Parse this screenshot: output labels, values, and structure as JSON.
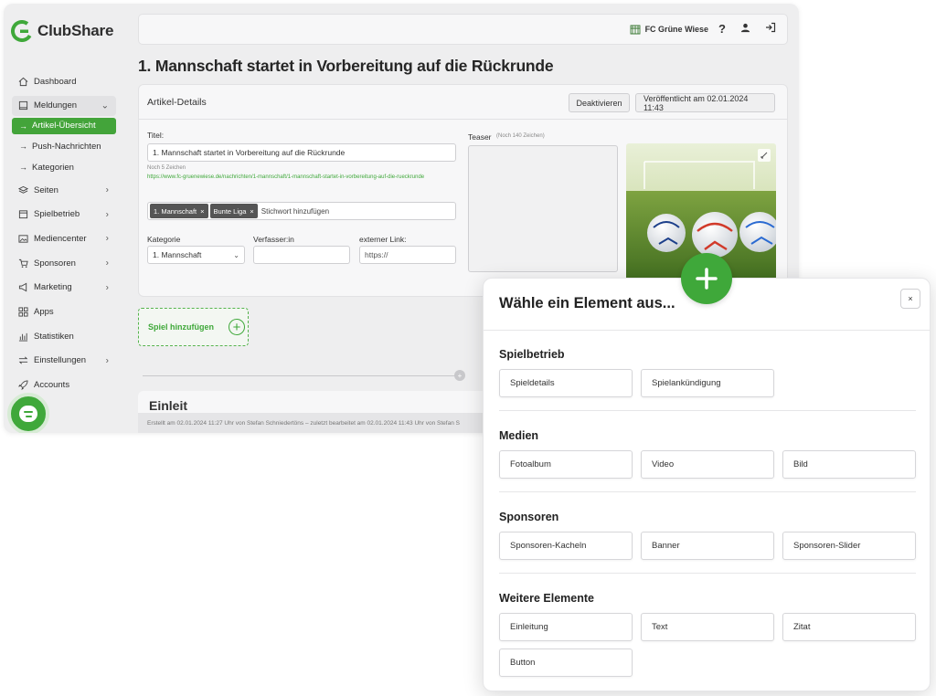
{
  "app": {
    "logo_text": "ClubShare",
    "club_name": "FC Grüne Wiese",
    "page_title": "1. Mannschaft startet in Vorbereitung auf die Rückrunde"
  },
  "sidebar": {
    "items": [
      {
        "label": "Dashboard",
        "icon": "home-icon"
      },
      {
        "label": "Meldungen",
        "icon": "book-icon"
      },
      {
        "label": "Seiten",
        "icon": "layers-icon"
      },
      {
        "label": "Spielbetrieb",
        "icon": "calendar-icon"
      },
      {
        "label": "Mediencenter",
        "icon": "image-icon"
      },
      {
        "label": "Sponsoren",
        "icon": "cart-icon"
      },
      {
        "label": "Marketing",
        "icon": "megaphone-icon"
      },
      {
        "label": "Apps",
        "icon": "grid-icon"
      },
      {
        "label": "Statistiken",
        "icon": "bar-chart-icon"
      },
      {
        "label": "Einstellungen",
        "icon": "arrows-icon"
      },
      {
        "label": "Accounts",
        "icon": "rocket-icon"
      }
    ],
    "subitems": [
      {
        "label": "Artikel-Übersicht"
      },
      {
        "label": "Push-Nachrichten"
      },
      {
        "label": "Kategorien"
      }
    ]
  },
  "article": {
    "card_title": "Artikel-Details",
    "deactivate_label": "Deaktivieren",
    "published_label": "Veröffentlicht am 02.01.2024 11:43",
    "title_label": "Titel:",
    "title_value": "1. Mannschaft startet in Vorbereitung auf die Rückrunde",
    "chars_left": "Noch 5 Zeichen",
    "url": "https://www.fc-gruenewiese.de/nachrichten/1-mannschaft/1-mannschaft-startet-in-vorbereitung-auf-die-rueckrunde",
    "tags": [
      "1. Mannschaft",
      "Bunte Liga"
    ],
    "tag_placeholder": "Stichwort hinzufügen",
    "category_label": "Kategorie",
    "category_value": "1. Mannschaft",
    "author_label": "Verfasser:in",
    "author_value": "",
    "extlink_label": "externer Link:",
    "extlink_placeholder": "https://",
    "teaser_label": "Teaser",
    "teaser_hint": "(Noch 140 Zeichen)",
    "add_game_label": "Spiel hinzufügen",
    "next_heading": "Einleit",
    "footer_text": "Erstellt am 02.01.2024 11:27 Uhr von Stefan Schniedertöns  –  zuletzt bearbeitet am 02.01.2024 11:43 Uhr von Stefan S"
  },
  "modal": {
    "title": "Wähle ein Element aus...",
    "close_label": "×",
    "sections": [
      {
        "title": "Spielbetrieb",
        "items": [
          "Spieldetails",
          "Spielankündigung"
        ]
      },
      {
        "title": "Medien",
        "items": [
          "Fotoalbum",
          "Video",
          "Bild"
        ]
      },
      {
        "title": "Sponsoren",
        "items": [
          "Sponsoren-Kacheln",
          "Banner",
          "Sponsoren-Slider"
        ]
      },
      {
        "title": "Weitere Elemente",
        "items": [
          "Einleitung",
          "Text",
          "Zitat",
          "Button"
        ]
      }
    ]
  },
  "colors": {
    "brand_green": "#3fa83a",
    "sidebar_active": "#43a43a"
  }
}
